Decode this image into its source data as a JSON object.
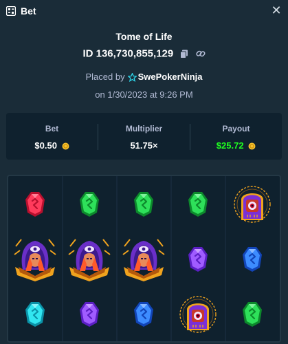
{
  "header": {
    "title": "Bet",
    "close_icon": "close-icon",
    "bet_icon": "bet-slip-icon"
  },
  "game": {
    "title": "Tome of Life",
    "id_text": "ID 136,730,855,129",
    "placed_by_label": "Placed by",
    "username": "SwePokerNinja",
    "date": "on 1/30/2023 at 9:26 PM"
  },
  "stats": {
    "bet": {
      "label": "Bet",
      "value": "$0.50"
    },
    "multiplier": {
      "label": "Multiplier",
      "value": "51.75×"
    },
    "payout": {
      "label": "Payout",
      "value": "$25.72"
    }
  },
  "colors": {
    "background": "#1a2c38",
    "panel": "#0f212e",
    "payout_green": "#1fff20",
    "coin": "#f6c12c",
    "muted_text": "#b1bad3"
  },
  "reels": [
    [
      "red-rune-gem",
      "sorceress-symbol",
      "cyan-rune-gem"
    ],
    [
      "green-rune-gem",
      "sorceress-symbol",
      "purple-rune-gem"
    ],
    [
      "green-rune-gem",
      "sorceress-symbol",
      "blue-rune-gem"
    ],
    [
      "green-rune-gem",
      "purple-rune-gem",
      "tome-scatter-symbol"
    ],
    [
      "tome-scatter-symbol",
      "blue-rune-gem",
      "green-rune-gem"
    ]
  ]
}
